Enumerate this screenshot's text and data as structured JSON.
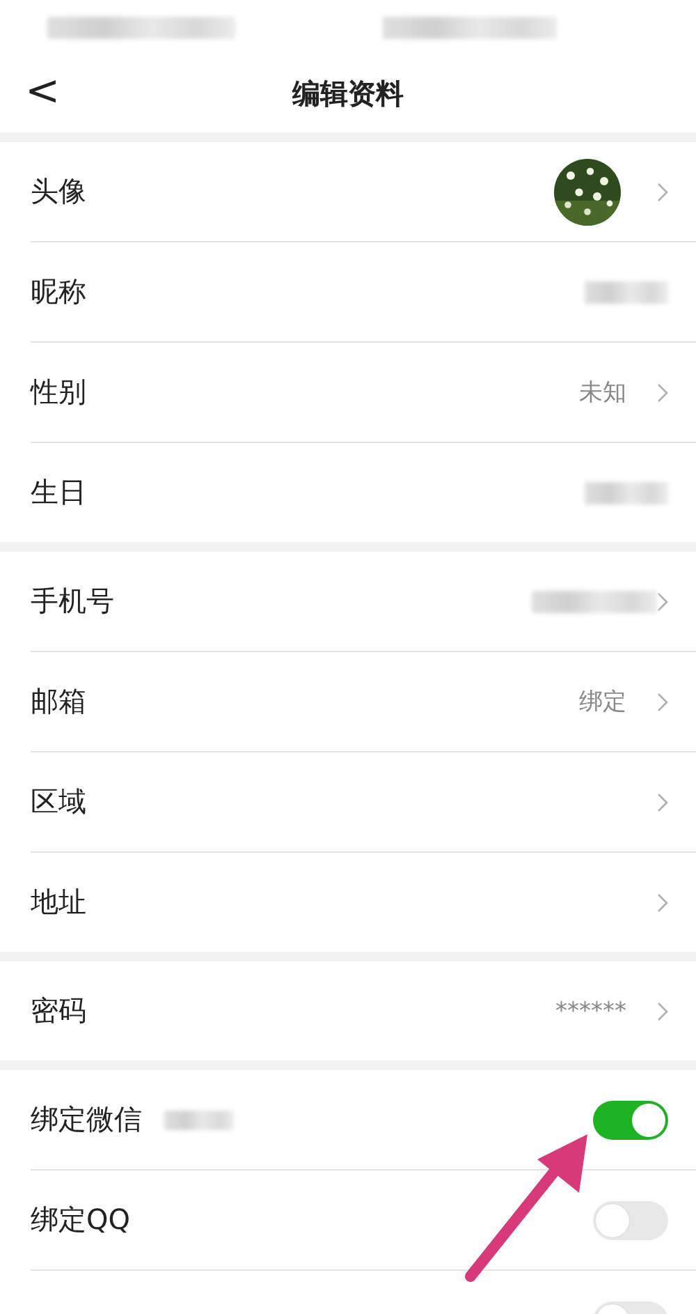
{
  "status_bar": {
    "blurred": true
  },
  "nav": {
    "back": "<",
    "title": "编辑资料"
  },
  "sections": [
    {
      "rows": [
        {
          "kind": "avatar",
          "label": "头像",
          "chevron": true
        },
        {
          "kind": "blurred",
          "label": "昵称",
          "chevron": false
        },
        {
          "kind": "value",
          "label": "性别",
          "value": "未知",
          "chevron": true
        },
        {
          "kind": "blurred",
          "label": "生日",
          "chevron": false
        }
      ]
    },
    {
      "rows": [
        {
          "kind": "blurred",
          "label": "手机号",
          "chevron": true
        },
        {
          "kind": "value",
          "label": "邮箱",
          "value": "绑定",
          "chevron": true
        },
        {
          "kind": "value",
          "label": "区域",
          "chevron": true
        },
        {
          "kind": "value",
          "label": "地址",
          "chevron": true
        }
      ]
    },
    {
      "rows": [
        {
          "kind": "value",
          "label": "密码",
          "value": "******",
          "chevron": true
        }
      ]
    },
    {
      "rows": [
        {
          "kind": "switch",
          "label": "绑定微信",
          "note_blurred": true,
          "on": true
        },
        {
          "kind": "switch",
          "label": "绑定QQ",
          "note_blurred": false,
          "on": false
        },
        {
          "kind": "switch",
          "note_blurred": false,
          "on": false
        }
      ]
    }
  ],
  "annotations": [
    {
      "kind": "arrow"
    }
  ]
}
